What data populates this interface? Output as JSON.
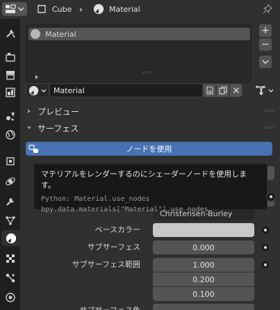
{
  "breadcrumb": {
    "object": "Cube",
    "material": "Material"
  },
  "material_slots": {
    "items": [
      {
        "label": "Material"
      }
    ]
  },
  "slot_buttons": {
    "add": "+",
    "remove": "−"
  },
  "material": {
    "name": "Material"
  },
  "panels": {
    "preview": "プレビュー",
    "surface": "サーフェス"
  },
  "use_nodes": {
    "label": "ノードを使用"
  },
  "tooltip": {
    "description": "マテリアルをレンダーするのにシェーダーノードを使用します。",
    "python": "Python: Material.use_nodes",
    "path": "bpy.data.materials[\"Material\"].use_nodes"
  },
  "surface": {
    "distribution": "Christensen-Burley",
    "base_color_label": "ベースカラー",
    "base_color_value": "#c8c8c8",
    "subsurface_label": "サブサーフェス",
    "subsurface_value": "0.000",
    "subsurface_radius_label": "サブサーフェス範囲",
    "subsurface_radius": [
      "1.000",
      "0.200",
      "0.100"
    ],
    "subsurface_color_label": "サブサーフェス色"
  },
  "colors": {
    "accent": "#4772b3",
    "panel_bg": "#303030",
    "tabbar_bg": "#1f1f1f"
  }
}
